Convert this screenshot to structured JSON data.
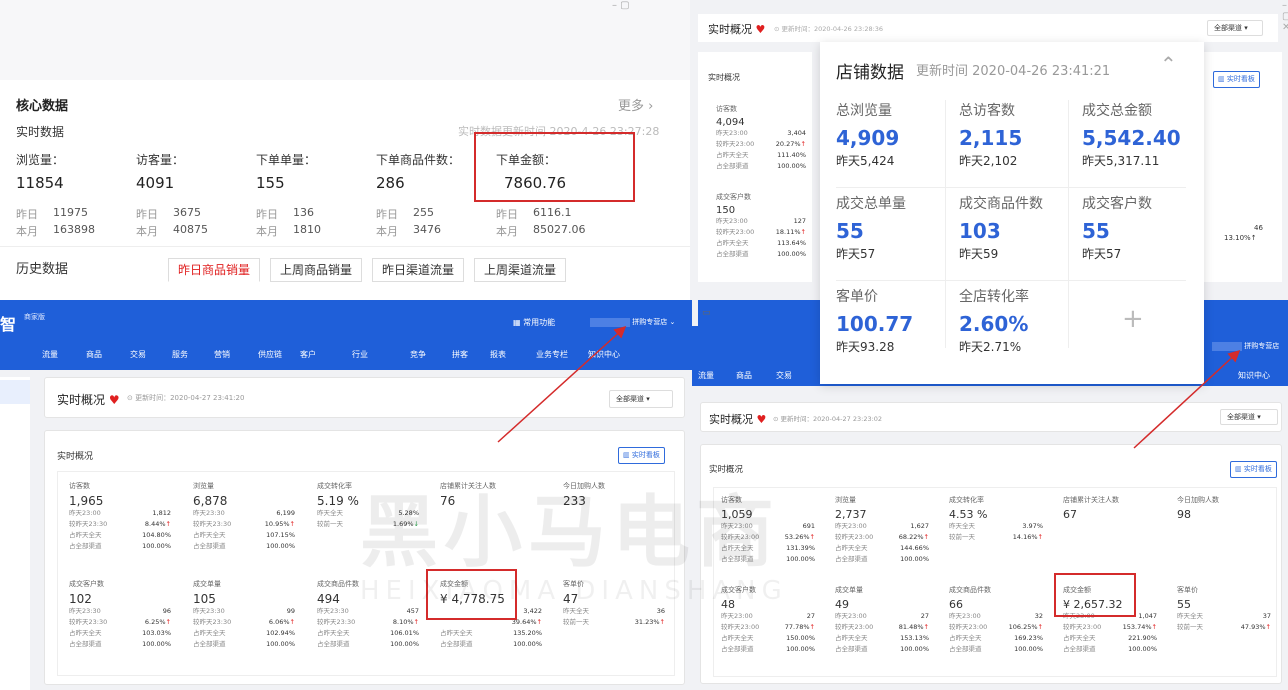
{
  "top_left": {
    "title": "核心数据",
    "more": "更多",
    "realtime": "实时数据",
    "updated": "实时数据更新时间 2020-4-26 23:27:28",
    "metrics": [
      {
        "label": "浏览量：",
        "value": "11854",
        "yd_label": "昨日",
        "yd": "11975",
        "mo_label": "本月",
        "mo": "163898"
      },
      {
        "label": "访客量：",
        "value": "4091",
        "yd_label": "昨日",
        "yd": "3675",
        "mo_label": "本月",
        "mo": "40875"
      },
      {
        "label": "下单单量：",
        "value": "155",
        "yd_label": "昨日",
        "yd": "136",
        "mo_label": "本月",
        "mo": "1810"
      },
      {
        "label": "下单商品件数：",
        "value": "286",
        "yd_label": "昨日",
        "yd": "255",
        "mo_label": "本月",
        "mo": "3476"
      },
      {
        "label": "下单金额：",
        "value": "7860.76",
        "yd_label": "昨日",
        "yd": "6116.1",
        "mo_label": "本月",
        "mo": "85027.06"
      }
    ],
    "history": "历史数据",
    "tabs": [
      "昨日商品销量",
      "上周商品销量",
      "昨日渠道流量",
      "上周渠道流量"
    ]
  },
  "bottom_left": {
    "brand": "智",
    "brand_sub": "商家版",
    "common": "常用功能",
    "shop": "拼购专营店",
    "nav": [
      "流量",
      "商品",
      "交易",
      "服务",
      "营销",
      "供应链",
      "客户",
      "行业",
      "竞争",
      "拼客",
      "报表",
      "业务专栏",
      "知识中心"
    ],
    "header_title": "实时概况",
    "updated": "更新时间：2020-04-27 23:41:20",
    "channel": "全部渠道",
    "section": "实时概况",
    "board": "实时看板",
    "row1": [
      {
        "t": "访客数",
        "v": "1,965",
        "r": [
          [
            "昨天23:00",
            "1,812"
          ],
          [
            "较昨天23:30",
            "8.44%↑"
          ],
          [
            "占昨天全天",
            "104.80%"
          ],
          [
            "占全部渠道",
            "100.00%"
          ]
        ]
      },
      {
        "t": "浏览量",
        "v": "6,878",
        "r": [
          [
            "昨天23:30",
            "6,199"
          ],
          [
            "较昨天23:30",
            "10.95%↑"
          ],
          [
            "占昨天全天",
            "107.15%"
          ],
          [
            "占全部渠道",
            "100.00%"
          ]
        ]
      },
      {
        "t": "成交转化率",
        "v": "5.19 %",
        "r": [
          [
            "昨天全天",
            "5.28%"
          ],
          [
            "较前一天",
            "1.69%↓"
          ]
        ]
      },
      {
        "t": "店铺累计关注人数",
        "v": "76",
        "r": []
      },
      {
        "t": "今日加购人数",
        "v": "233",
        "r": []
      }
    ],
    "row2": [
      {
        "t": "成交客户数",
        "v": "102",
        "r": [
          [
            "昨天23:30",
            "96"
          ],
          [
            "较昨天23:30",
            "6.25%↑"
          ],
          [
            "占昨天全天",
            "103.03%"
          ],
          [
            "占全部渠道",
            "100.00%"
          ]
        ]
      },
      {
        "t": "成交单量",
        "v": "105",
        "r": [
          [
            "昨天23:30",
            "99"
          ],
          [
            "较昨天23:30",
            "6.06%↑"
          ],
          [
            "占昨天全天",
            "102.94%"
          ],
          [
            "占全部渠道",
            "100.00%"
          ]
        ]
      },
      {
        "t": "成交商品件数",
        "v": "494",
        "r": [
          [
            "昨天23:30",
            "457"
          ],
          [
            "较昨天23:30",
            "8.10%↑"
          ],
          [
            "占昨天全天",
            "106.01%"
          ],
          [
            "占全部渠道",
            "100.00%"
          ]
        ]
      },
      {
        "t": "成交金额",
        "v": "¥ 4,778.75",
        "r": [
          [
            "",
            "3,422"
          ],
          [
            "",
            "39.64%↑"
          ],
          [
            "占昨天全天",
            "135.20%"
          ],
          [
            "占全部渠道",
            "100.00%"
          ]
        ]
      },
      {
        "t": "客单价",
        "v": "47",
        "r": [
          [
            "昨天全天",
            "36"
          ],
          [
            "较前一天",
            "31.23%↑"
          ]
        ]
      }
    ]
  },
  "top_right": {
    "header_title": "实时概况",
    "updated": "更新时间：2020-04-26 23:28:36",
    "channel": "全部渠道",
    "section": "实时概况",
    "board": "实时看板",
    "col1": [
      {
        "t": "访客数",
        "v": "4,094",
        "r": [
          [
            "昨天23:00",
            "3,404"
          ],
          [
            "较昨天23:00",
            "20.27%↑"
          ],
          [
            "占昨天全天",
            "111.40%"
          ],
          [
            "占全部渠道",
            "100.00%"
          ]
        ]
      },
      {
        "t": "成交客户数",
        "v": "150",
        "r": [
          [
            "昨天23:00",
            "127"
          ],
          [
            "较昨天23:00",
            "18.11%↑"
          ],
          [
            "占昨天全天",
            "113.64%"
          ],
          [
            "占全部渠道",
            "100.00%"
          ]
        ]
      }
    ],
    "right_vals": [
      "46",
      "13.10%↑"
    ]
  },
  "popup": {
    "title": "店铺数据",
    "updated": "更新时间 2020-04-26 23:41:21",
    "cells": [
      {
        "label": "总浏览量",
        "value": "4,909",
        "yd": "昨天5,424"
      },
      {
        "label": "总访客数",
        "value": "2,115",
        "yd": "昨天2,102"
      },
      {
        "label": "成交总金额",
        "value": "5,542.40",
        "yd": "昨天5,317.11"
      },
      {
        "label": "成交总单量",
        "value": "55",
        "yd": "昨天57"
      },
      {
        "label": "成交商品件数",
        "value": "103",
        "yd": "昨天59"
      },
      {
        "label": "成交客户数",
        "value": "55",
        "yd": "昨天57"
      },
      {
        "label": "客单价",
        "value": "100.77",
        "yd": "昨天93.28"
      },
      {
        "label": "全店转化率",
        "value": "2.60%",
        "yd": "昨天2.71%"
      }
    ],
    "plus": "+"
  },
  "bottom_right": {
    "nav": [
      "流量",
      "商品",
      "交易",
      "知识中心"
    ],
    "shop": "拼购专营店",
    "header_title": "实时概况",
    "updated": "更新时间：2020-04-27 23:23:02",
    "channel": "全部渠道",
    "section": "实时概况",
    "board": "实时看板",
    "row1": [
      {
        "t": "访客数",
        "v": "1,059",
        "r": [
          [
            "昨天23:00",
            "691"
          ],
          [
            "较昨天23:00",
            "53.26%↑"
          ],
          [
            "占昨天全天",
            "131.39%"
          ],
          [
            "占全部渠道",
            "100.00%"
          ]
        ]
      },
      {
        "t": "浏览量",
        "v": "2,737",
        "r": [
          [
            "昨天23:00",
            "1,627"
          ],
          [
            "较昨天23:00",
            "68.22%↑"
          ],
          [
            "占昨天全天",
            "144.66%"
          ],
          [
            "占全部渠道",
            "100.00%"
          ]
        ]
      },
      {
        "t": "成交转化率",
        "v": "4.53 %",
        "r": [
          [
            "昨天全天",
            "3.97%"
          ],
          [
            "较前一天",
            "14.16%↑"
          ]
        ]
      },
      {
        "t": "店铺累计关注人数",
        "v": "67",
        "r": []
      },
      {
        "t": "今日加购人数",
        "v": "98",
        "r": []
      }
    ],
    "row2": [
      {
        "t": "成交客户数",
        "v": "48",
        "r": [
          [
            "昨天23:00",
            "27"
          ],
          [
            "较昨天23:00",
            "77.78%↑"
          ],
          [
            "占昨天全天",
            "150.00%"
          ],
          [
            "占全部渠道",
            "100.00%"
          ]
        ]
      },
      {
        "t": "成交单量",
        "v": "49",
        "r": [
          [
            "昨天23:00",
            "27"
          ],
          [
            "较昨天23:00",
            "81.48%↑"
          ],
          [
            "占昨天全天",
            "153.13%"
          ],
          [
            "占全部渠道",
            "100.00%"
          ]
        ]
      },
      {
        "t": "成交商品件数",
        "v": "66",
        "r": [
          [
            "昨天23:00",
            "32"
          ],
          [
            "较昨天23:00",
            "106.25%↑"
          ],
          [
            "占昨天全天",
            "169.23%"
          ],
          [
            "占全部渠道",
            "100.00%"
          ]
        ]
      },
      {
        "t": "成交金额",
        "v": "¥ 2,657.32",
        "r": [
          [
            "昨天23:00",
            "1,047"
          ],
          [
            "较昨天23:00",
            "153.74%↑"
          ],
          [
            "占昨天全天",
            "221.90%"
          ],
          [
            "占全部渠道",
            "100.00%"
          ]
        ]
      },
      {
        "t": "客单价",
        "v": "55",
        "r": [
          [
            "昨天全天",
            "37"
          ],
          [
            "较前一天",
            "47.93%↑"
          ]
        ]
      }
    ]
  },
  "watermark": {
    "cn": "黑小马电商",
    "en": "HEIXIAOMA DIANSHANG"
  },
  "colors": {
    "nav_blue": "#1f5fd9",
    "accent_blue": "#2e63d6",
    "red": "#d42b2b",
    "up_red": "#e02020"
  }
}
